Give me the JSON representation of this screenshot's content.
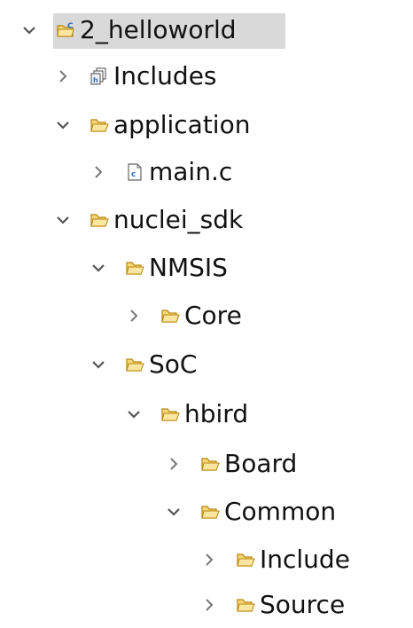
{
  "project_tree": {
    "items": [
      {
        "label": "2_helloworld",
        "icon": "project-folder-icon",
        "state": "expanded",
        "selected": true
      },
      {
        "label": "Includes",
        "icon": "includes-icon",
        "state": "collapsed"
      },
      {
        "label": "application",
        "icon": "folder-icon",
        "state": "expanded"
      },
      {
        "label": "main.c",
        "icon": "c-source-file-icon",
        "state": "collapsed"
      },
      {
        "label": "nuclei_sdk",
        "icon": "folder-icon",
        "state": "expanded"
      },
      {
        "label": "NMSIS",
        "icon": "folder-icon",
        "state": "expanded"
      },
      {
        "label": "Core",
        "icon": "folder-icon",
        "state": "collapsed"
      },
      {
        "label": "SoC",
        "icon": "folder-icon",
        "state": "expanded"
      },
      {
        "label": "hbird",
        "icon": "folder-icon",
        "state": "expanded"
      },
      {
        "label": "Board",
        "icon": "folder-icon",
        "state": "collapsed"
      },
      {
        "label": "Common",
        "icon": "folder-icon",
        "state": "expanded"
      },
      {
        "label": "Include",
        "icon": "folder-icon",
        "state": "collapsed"
      },
      {
        "label": "Source",
        "icon": "folder-icon",
        "state": "collapsed"
      }
    ]
  },
  "colors": {
    "selection_background": "#d9d9d9",
    "folder_fill": "#f6d77a",
    "folder_stroke": "#b8860b",
    "twisty": "#555555"
  }
}
